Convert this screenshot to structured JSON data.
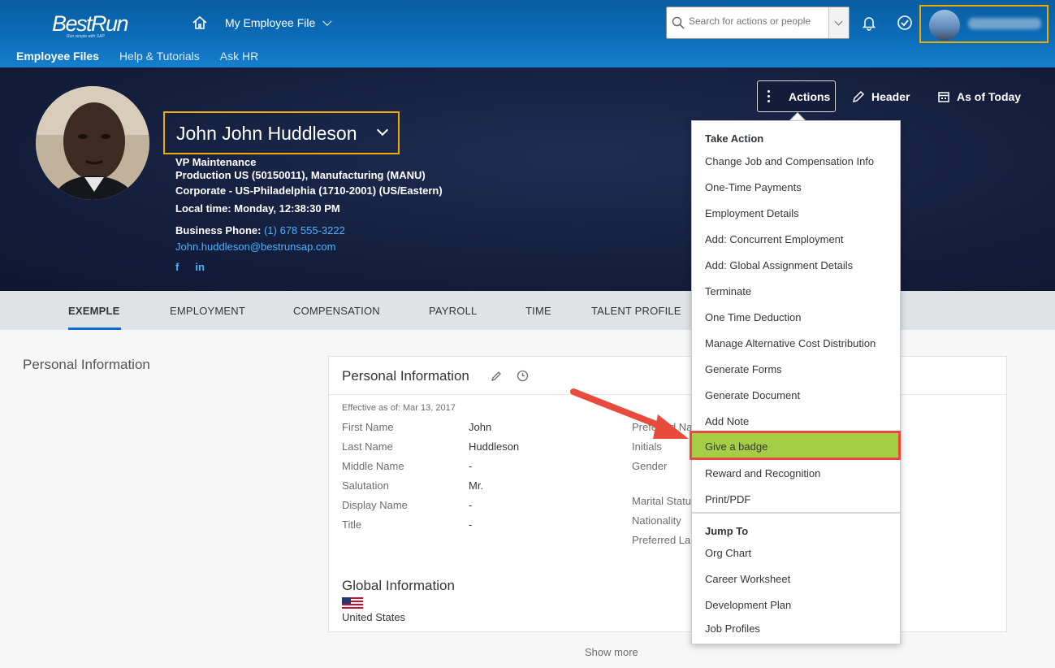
{
  "shell": {
    "logo": "BestRun",
    "logo_tagline": "Run simple with SAP",
    "nav_title": "My Employee File",
    "search_placeholder": "Search for actions or people",
    "subnav": [
      "Employee Files",
      "Help & Tutorials",
      "Ask HR"
    ]
  },
  "profile": {
    "name": "John John Huddleson",
    "title": "VP Maintenance",
    "line1": "Production US (50150011), Manufacturing (MANU)",
    "line2": "Corporate - US-Philadelphia (1710-2001) (US/Eastern)",
    "local_time": "Local time: Monday, 12:38:30 PM",
    "phone_label": "Business Phone:",
    "phone": "(1) 678 555-3222",
    "email": "John.huddleson@bestrunsap.com",
    "social": [
      "f",
      "in"
    ]
  },
  "header_actions": {
    "actions": "Actions",
    "header": "Header",
    "as_of": "As of Today"
  },
  "tabs": [
    "EXEMPLE",
    "EMPLOYMENT",
    "COMPENSATION",
    "PAYROLL",
    "TIME",
    "TALENT PROFILE"
  ],
  "section_title": "Personal Information",
  "card": {
    "title": "Personal Information",
    "effective": "Effective as of: Mar 13, 2017",
    "fields": [
      {
        "label": "First Name",
        "value": "John"
      },
      {
        "label": "Last Name",
        "value": "Huddleson"
      },
      {
        "label": "Middle Name",
        "value": "-"
      },
      {
        "label": "Salutation",
        "value": "Mr."
      },
      {
        "label": "Display Name",
        "value": "-"
      },
      {
        "label": "Title",
        "value": "-"
      }
    ],
    "right_labels": [
      "Preferred Na",
      "Initials",
      "Gender",
      "Marital Statu",
      "Nationality",
      "Preferred La"
    ],
    "global_title": "Global Information",
    "country": "United States"
  },
  "show_more": "Show more",
  "menu": {
    "take_action": "Take Action",
    "items": [
      "Change Job and Compensation Info",
      "One-Time Payments",
      "Employment Details",
      "Add: Concurrent Employment",
      "Add: Global Assignment Details",
      "Terminate",
      "One Time Deduction",
      "Manage Alternative Cost Distribution",
      "Generate Forms",
      "Generate Document",
      "Add Note"
    ],
    "highlighted": "Give a badge",
    "items_after": [
      "Reward and Recognition",
      "Print/PDF"
    ],
    "jump_to": "Jump To",
    "jump_items": [
      "Org Chart",
      "Career Worksheet",
      "Development Plan",
      "Job Profiles"
    ]
  },
  "colors": {
    "shell_blue": "#0b6cb8",
    "header_navy": "#15203f",
    "highlight_orange": "#f0ab00",
    "highlight_red": "#e84b3c",
    "badge_green": "#a5cd46",
    "link_blue": "#4db1ff"
  }
}
